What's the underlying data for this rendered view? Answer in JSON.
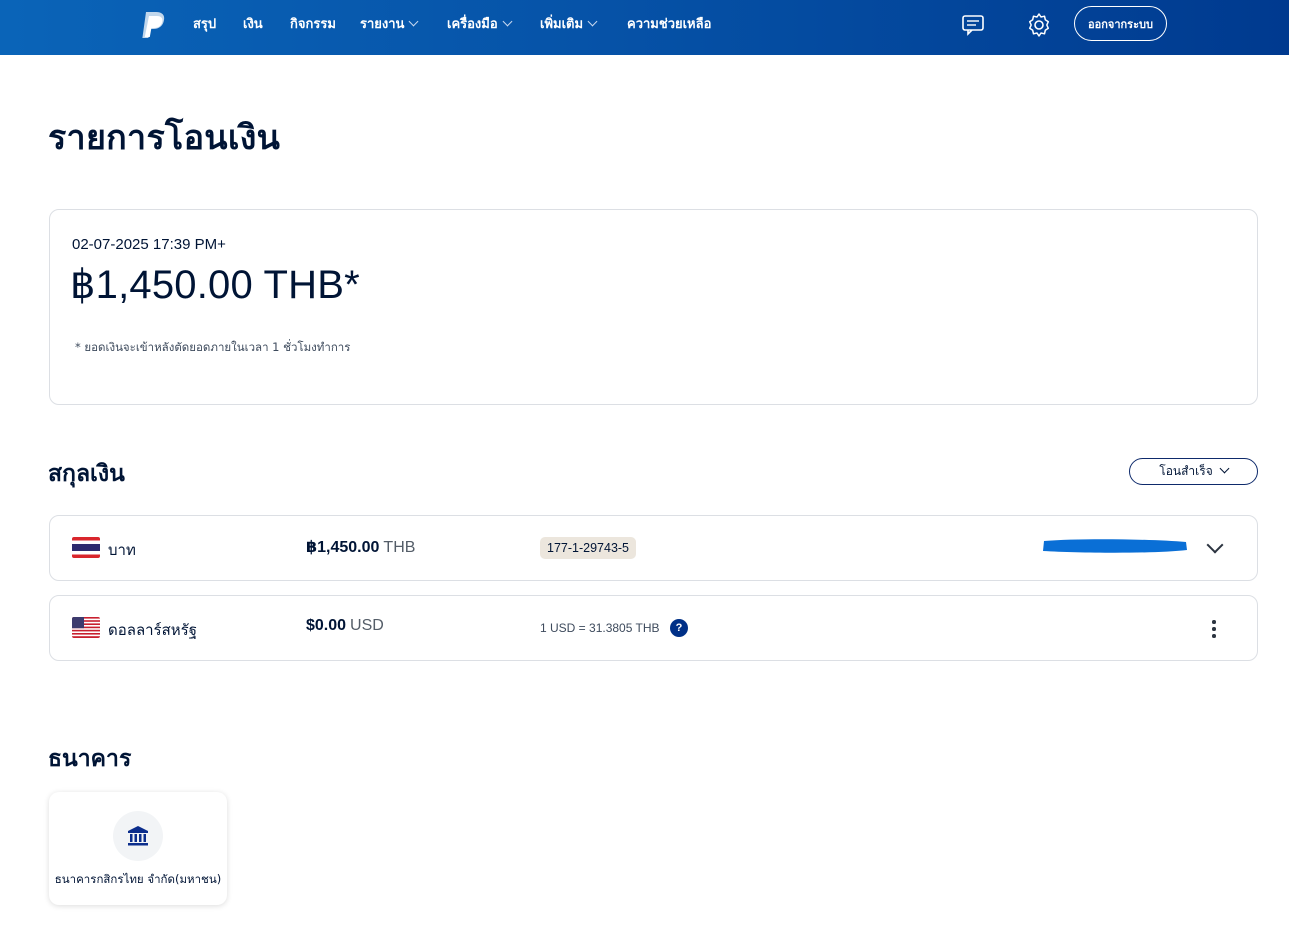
{
  "header": {
    "nav": [
      {
        "label": "สรุป",
        "dropdown": false
      },
      {
        "label": "เงิน",
        "dropdown": false
      },
      {
        "label": "กิจกรรม",
        "dropdown": false
      },
      {
        "label": "รายงาน",
        "dropdown": true
      },
      {
        "label": "เครื่องมือ",
        "dropdown": true
      },
      {
        "label": "เพิ่มเติม",
        "dropdown": true
      },
      {
        "label": "ความช่วยเหลือ",
        "dropdown": false
      }
    ],
    "icons": [
      "paypal-logo",
      "message-icon",
      "gear-icon"
    ],
    "logout_label": "ออกจากระบบ"
  },
  "page": {
    "title": "รายการโอนเงิน"
  },
  "transfer": {
    "datetime": "02-07-2025 17:39 PM+",
    "amount": "฿1,450.00 THB*",
    "note": "* ยอดเงินจะเข้าหลังตัดยอดภายในเวลา 1 ชั่วโมงทำการ"
  },
  "currencies": {
    "title": "สกุลเงิน",
    "filter_label": "โอนสำเร็จ",
    "rows": [
      {
        "flag": "thailand-flag",
        "name": "บาท",
        "amount": "฿1,450.00",
        "code": "THB",
        "account": "177-1-29743-5",
        "redacted": true
      },
      {
        "flag": "usa-flag",
        "name": "ดอลลาร์สหรัฐ",
        "amount": "$0.00",
        "code": "USD",
        "rate": "1 USD = 31.3805 THB"
      }
    ]
  },
  "bank": {
    "title": "ธนาคาร",
    "name": "ธนาคารกสิกรไทย จำกัด(มหาชน)",
    "icon": "bank-icon"
  },
  "colors": {
    "header_start": "#0a64b8",
    "header_end": "#003a8f",
    "text_primary": "#001435",
    "badge_bg": "#ece6dd",
    "redact_blue": "#0a6fd6"
  }
}
